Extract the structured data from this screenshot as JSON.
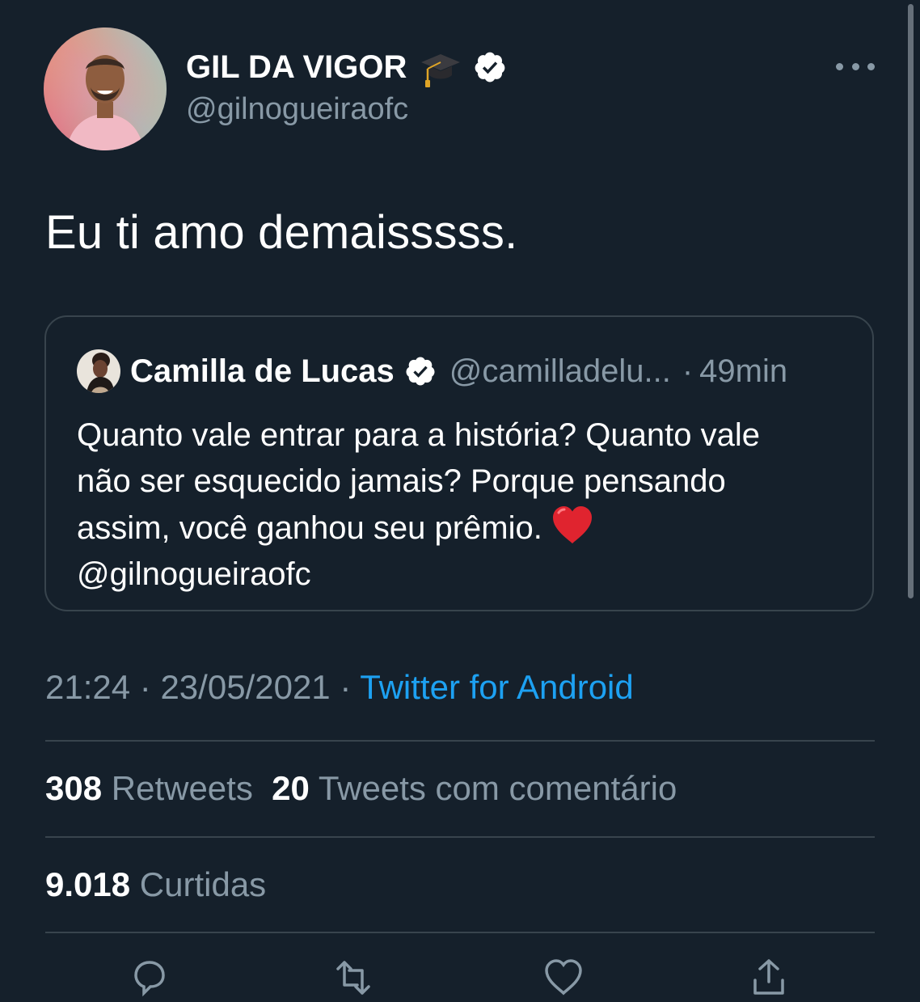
{
  "author": {
    "name": "GIL DA VIGOR",
    "handle": "@gilnogueiraofc"
  },
  "tweet": {
    "text": "Eu ti amo demaisssss."
  },
  "quote": {
    "name": "Camilla de Lucas",
    "handle": "@camilladelu...",
    "separator": "·",
    "time": "49min",
    "lines": [
      "Quanto vale entrar para a história? Quanto vale",
      "não ser esquecido jamais? Porque pensando",
      "assim, você ganhou seu prêmio.",
      "@gilnogueiraofc"
    ]
  },
  "meta": {
    "time": "21:24",
    "sep1": "·",
    "date": "23/05/2021",
    "sep2": "·",
    "source": "Twitter for Android"
  },
  "stats": {
    "retweets_count": "308",
    "retweets_label": "Retweets",
    "quotes_count": "20",
    "quotes_label": "Tweets com comentário",
    "likes_count": "9.018",
    "likes_label": "Curtidas"
  },
  "icons": {
    "verified": "verified-badge-icon",
    "graduation": "graduation-cap-emoji",
    "heart": "red-heart-emoji",
    "more": "more-options-icon"
  },
  "colors": {
    "background": "#15202b",
    "secondary_text": "#8899a6",
    "accent": "#1da1f2",
    "border": "#38444d"
  }
}
